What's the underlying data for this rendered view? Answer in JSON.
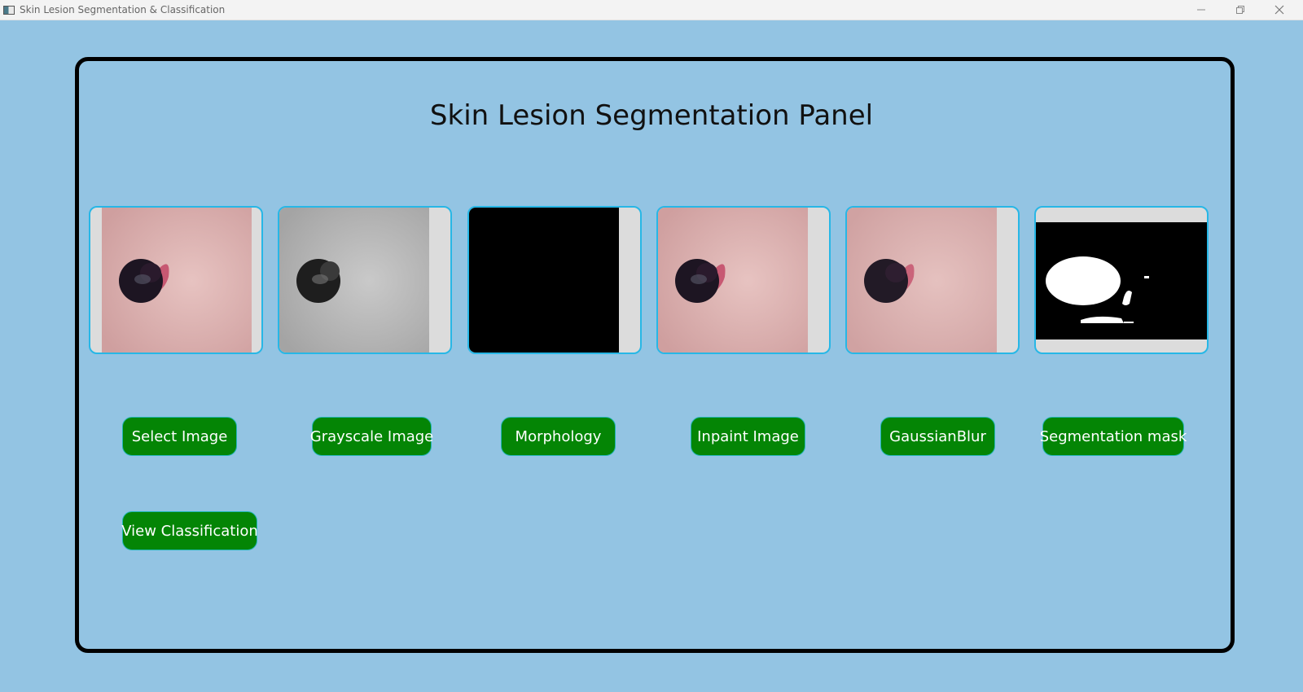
{
  "window": {
    "title": "Skin Lesion Segmentation & Classification"
  },
  "panel": {
    "title": "Skin Lesion Segmentation Panel"
  },
  "images": [
    {
      "name": "original",
      "icon": "skin-lesion-color-image"
    },
    {
      "name": "grayscale",
      "icon": "skin-lesion-grayscale-image"
    },
    {
      "name": "morphology",
      "icon": "black-morphology-image"
    },
    {
      "name": "inpaint",
      "icon": "skin-lesion-inpainted-image"
    },
    {
      "name": "gaussianblur",
      "icon": "skin-lesion-blurred-image"
    },
    {
      "name": "segmentation-mask",
      "icon": "binary-mask-image"
    }
  ],
  "buttons": {
    "select_image": "Select Image",
    "grayscale_image": "Grayscale Image",
    "morphology": "Morphology",
    "inpaint_image": "Inpaint Image",
    "gaussian_blur": "GaussianBlur",
    "segmentation_mask": "Segmentation mask",
    "view_classification": "View Classification"
  },
  "colors": {
    "background": "#93c4e3",
    "button": "#048505",
    "frame_border": "#27b7e6"
  }
}
